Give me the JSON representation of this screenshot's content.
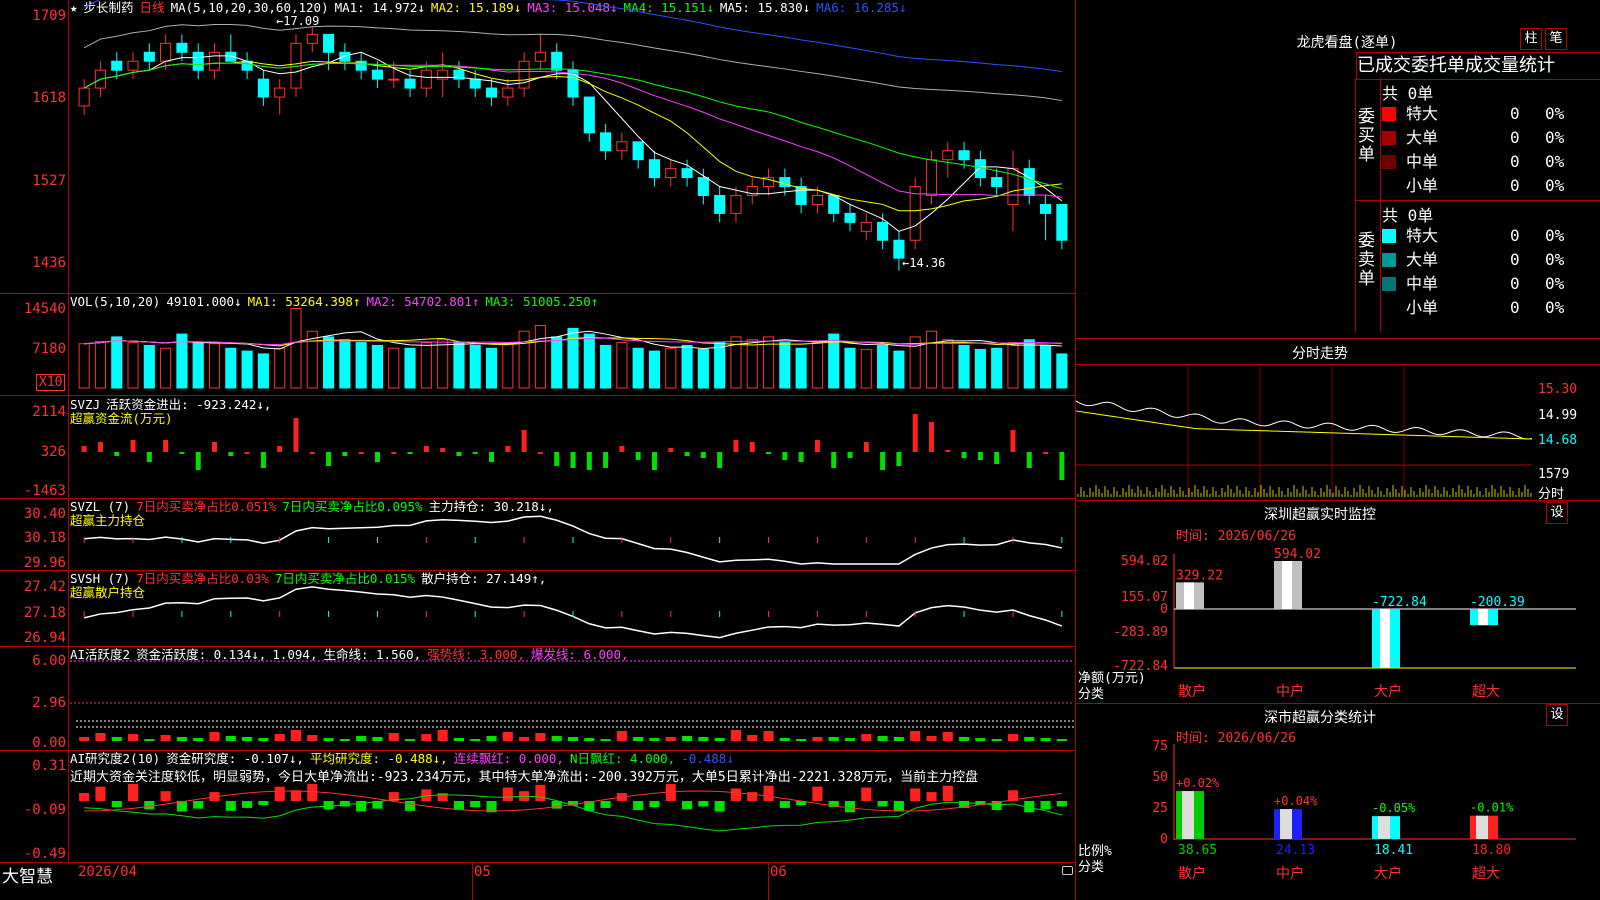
{
  "stock": {
    "name": "步长制药",
    "period": "日线",
    "star": "★"
  },
  "main_header": {
    "ma_params": "MA(5,10,20,30,60,120)",
    "ma1": "MA1: 14.972↓",
    "ma2": "MA2: 15.189↓",
    "ma3": "MA3: 15.048↓",
    "ma4": "MA4: 15.151↓",
    "ma5": "MA5: 15.830↓",
    "ma6": "MA6: 16.285↓"
  },
  "main_axis": [
    "1709",
    "1618",
    "1527",
    "1436"
  ],
  "annotations": {
    "high": "←17.09",
    "low": "←14.36"
  },
  "vol_header": {
    "label": "VOL(5,10,20)",
    "value": "49101.000↓",
    "ma1": "MA1: 53264.398↑",
    "ma2": "MA2: 54702.801↑",
    "ma3": "MA3: 51005.250↑"
  },
  "vol_axis": [
    "14540",
    "7180"
  ],
  "vol_unit": "X10",
  "svzj": {
    "label": "SVZJ",
    "desc": "活跃资金进出: -923.242↓,",
    "sub": "超赢资金流(万元)",
    "axis": [
      "2114",
      "326",
      "-1463"
    ]
  },
  "svzl": {
    "label": "SVZL (7)",
    "t1": "7日内买卖净占比0.051%",
    "t2": "7日内买卖净占比0.095%",
    "t3": "主力持仓: 30.218↓,",
    "sub": "超赢主力持仓",
    "axis": [
      "30.40",
      "30.18",
      "29.96"
    ]
  },
  "svsh": {
    "label": "SVSH (7)",
    "t1": "7日内买卖净占比0.03%",
    "t2": "7日内买卖净占比0.015%",
    "t3": "散户持仓: 27.149↑,",
    "sub": "超赢散户持仓",
    "axis": [
      "27.42",
      "27.18",
      "26.94"
    ]
  },
  "ai_act": {
    "label": "AI活跃度2",
    "t1": "资金活跃度: 0.134↓,",
    "t2": "1.094,",
    "t3": "生命线: 1.560,",
    "t4": "强势线: 3.000,",
    "t5": "爆发线: 6.000,",
    "axis": [
      "6.00",
      "2.96",
      "0.00"
    ]
  },
  "ai_res": {
    "label": "AI研究度2(10)",
    "t1": "资金研究度: -0.107↓,",
    "t2": "平均研究度: -0.488↓,",
    "t3": "连续飘红: 0.000,",
    "t4": "N日飘红: 4.000,",
    "t5": "-0.488↓",
    "comment": "近期大资金关注度较低，明显弱势，今日大单净流出:-923.234万元，其中特大单净流出:-200.392万元，大单5日累计净出-2221.328万元，当前主力控盘",
    "axis": [
      "0.31",
      "-0.09",
      "-0.49"
    ]
  },
  "xaxis": {
    "d1": "2026/04",
    "d2": "05",
    "d3": "06"
  },
  "brand": "大智慧",
  "right": {
    "lhb_title": "龙虎看盘(逐单)",
    "btn1": "柱",
    "btn2": "笔",
    "lhb_tabs": "已成交委托单成交量统计",
    "buy": {
      "side": "委买单",
      "total": "共 0单",
      "rows": [
        {
          "name": "特大",
          "v": "0",
          "p": "0%",
          "color": "#ff0000"
        },
        {
          "name": "大单",
          "v": "0",
          "p": "0%",
          "color": "#a00000"
        },
        {
          "name": "中单",
          "v": "0",
          "p": "0%",
          "color": "#700000"
        },
        {
          "name": "小单",
          "v": "0",
          "p": "0%",
          "color": "#000000"
        }
      ]
    },
    "sell": {
      "side": "委卖单",
      "total": "共 0单",
      "rows": [
        {
          "name": "特大",
          "v": "0",
          "p": "0%",
          "color": "#00ffff"
        },
        {
          "name": "大单",
          "v": "0",
          "p": "0%",
          "color": "#009999"
        },
        {
          "name": "中单",
          "v": "0",
          "p": "0%",
          "color": "#007777"
        },
        {
          "name": "小单",
          "v": "0",
          "p": "0%",
          "color": "#000000"
        }
      ]
    },
    "fs_title": "分时走势",
    "fs_axis": [
      "15.30",
      "14.99",
      "14.68",
      "1579"
    ],
    "fs_label": "分时",
    "mon_title": "深圳超赢实时监控",
    "mon_btn": "设",
    "mon_time": "时间: 2026/06/26",
    "mon_axis": [
      "594.02",
      "155.07",
      "0",
      "-283.89",
      "-722.84"
    ],
    "mon_ylabel": "净额(万元)",
    "mon_xlabel": "分类",
    "mon_vals": [
      "329.22",
      "594.02",
      "-722.84",
      "-200.39"
    ],
    "mon_cats": [
      "散户",
      "中户",
      "大户",
      "超大"
    ],
    "cls_title": "深市超赢分类统计",
    "cls_btn": "设",
    "cls_time": "时间: 2026/06/26",
    "cls_axis": [
      "75",
      "50",
      "25",
      "0"
    ],
    "cls_ylabel": "比例%",
    "cls_xlabel": "分类",
    "cls_chg": [
      "+0.02%",
      "+0.04%",
      "-0.05%",
      "-0.01%"
    ],
    "cls_vals": [
      "38.65",
      "24.13",
      "18.41",
      "18.80"
    ],
    "cls_cats": [
      "散户",
      "中户",
      "大户",
      "超大"
    ]
  },
  "chart_data": {
    "type": "candlestick",
    "candles": [
      [
        16.2,
        16.5,
        16.1,
        16.4
      ],
      [
        16.4,
        16.7,
        16.3,
        16.6
      ],
      [
        16.7,
        16.8,
        16.5,
        16.6
      ],
      [
        16.6,
        16.8,
        16.5,
        16.7
      ],
      [
        16.8,
        16.9,
        16.6,
        16.7
      ],
      [
        16.7,
        17.0,
        16.6,
        16.9
      ],
      [
        16.9,
        17.0,
        16.7,
        16.8
      ],
      [
        16.8,
        16.9,
        16.5,
        16.6
      ],
      [
        16.6,
        16.9,
        16.5,
        16.8
      ],
      [
        16.8,
        17.0,
        16.7,
        16.7
      ],
      [
        16.7,
        16.8,
        16.5,
        16.6
      ],
      [
        16.5,
        16.6,
        16.2,
        16.3
      ],
      [
        16.3,
        16.5,
        16.1,
        16.4
      ],
      [
        16.4,
        17.0,
        16.3,
        16.9
      ],
      [
        16.9,
        17.09,
        16.8,
        17.0
      ],
      [
        17.0,
        17.0,
        16.6,
        16.8
      ],
      [
        16.8,
        16.9,
        16.6,
        16.7
      ],
      [
        16.7,
        16.8,
        16.5,
        16.6
      ],
      [
        16.6,
        16.7,
        16.4,
        16.5
      ],
      [
        16.5,
        16.7,
        16.4,
        16.5
      ],
      [
        16.5,
        16.6,
        16.3,
        16.4
      ],
      [
        16.4,
        16.7,
        16.3,
        16.6
      ],
      [
        16.5,
        16.8,
        16.3,
        16.6
      ],
      [
        16.6,
        16.7,
        16.4,
        16.5
      ],
      [
        16.5,
        16.6,
        16.3,
        16.4
      ],
      [
        16.4,
        16.5,
        16.2,
        16.3
      ],
      [
        16.3,
        16.5,
        16.2,
        16.4
      ],
      [
        16.4,
        16.8,
        16.3,
        16.7
      ],
      [
        16.7,
        17.0,
        16.6,
        16.8
      ],
      [
        16.8,
        16.9,
        16.5,
        16.6
      ],
      [
        16.6,
        16.7,
        16.2,
        16.3
      ],
      [
        16.3,
        16.3,
        15.8,
        15.9
      ],
      [
        15.9,
        16.0,
        15.6,
        15.7
      ],
      [
        15.7,
        15.9,
        15.6,
        15.8
      ],
      [
        15.8,
        15.8,
        15.5,
        15.6
      ],
      [
        15.6,
        15.7,
        15.3,
        15.4
      ],
      [
        15.4,
        15.6,
        15.3,
        15.5
      ],
      [
        15.5,
        15.6,
        15.3,
        15.4
      ],
      [
        15.4,
        15.5,
        15.1,
        15.2
      ],
      [
        15.2,
        15.3,
        14.9,
        15.0
      ],
      [
        15.0,
        15.3,
        14.9,
        15.2
      ],
      [
        15.2,
        15.4,
        15.1,
        15.3
      ],
      [
        15.3,
        15.5,
        15.2,
        15.4
      ],
      [
        15.4,
        15.5,
        15.2,
        15.3
      ],
      [
        15.3,
        15.4,
        15.0,
        15.1
      ],
      [
        15.1,
        15.3,
        15.0,
        15.2
      ],
      [
        15.2,
        15.2,
        14.9,
        15.0
      ],
      [
        15.0,
        15.1,
        14.8,
        14.9
      ],
      [
        14.8,
        15.0,
        14.7,
        14.9
      ],
      [
        14.9,
        15.0,
        14.6,
        14.7
      ],
      [
        14.7,
        14.8,
        14.36,
        14.5
      ],
      [
        14.7,
        15.4,
        14.6,
        15.3
      ],
      [
        15.2,
        15.7,
        15.1,
        15.6
      ],
      [
        15.6,
        15.8,
        15.4,
        15.7
      ],
      [
        15.7,
        15.8,
        15.5,
        15.6
      ],
      [
        15.6,
        15.7,
        15.3,
        15.4
      ],
      [
        15.4,
        15.5,
        15.2,
        15.3
      ],
      [
        15.1,
        15.7,
        14.8,
        15.5
      ],
      [
        15.5,
        15.6,
        15.1,
        15.2
      ],
      [
        15.1,
        15.2,
        14.7,
        15.0
      ],
      [
        15.1,
        15.1,
        14.6,
        14.7
      ]
    ],
    "volume": [
      7800,
      8200,
      9000,
      8000,
      7500,
      7000,
      9500,
      8000,
      7800,
      7000,
      6500,
      6000,
      7000,
      14000,
      10000,
      9000,
      8500,
      8000,
      7500,
      7000,
      7000,
      8000,
      8500,
      8000,
      7500,
      7000,
      8000,
      10000,
      11000,
      9000,
      10500,
      9500,
      7500,
      8000,
      7000,
      6500,
      7000,
      7500,
      6800,
      8000,
      9000,
      8500,
      9000,
      8000,
      7000,
      8000,
      9500,
      7000,
      6800,
      7500,
      6500,
      9000,
      10000,
      8500,
      7500,
      6800,
      7000,
      8000,
      8500,
      7500,
      6000
    ]
  }
}
